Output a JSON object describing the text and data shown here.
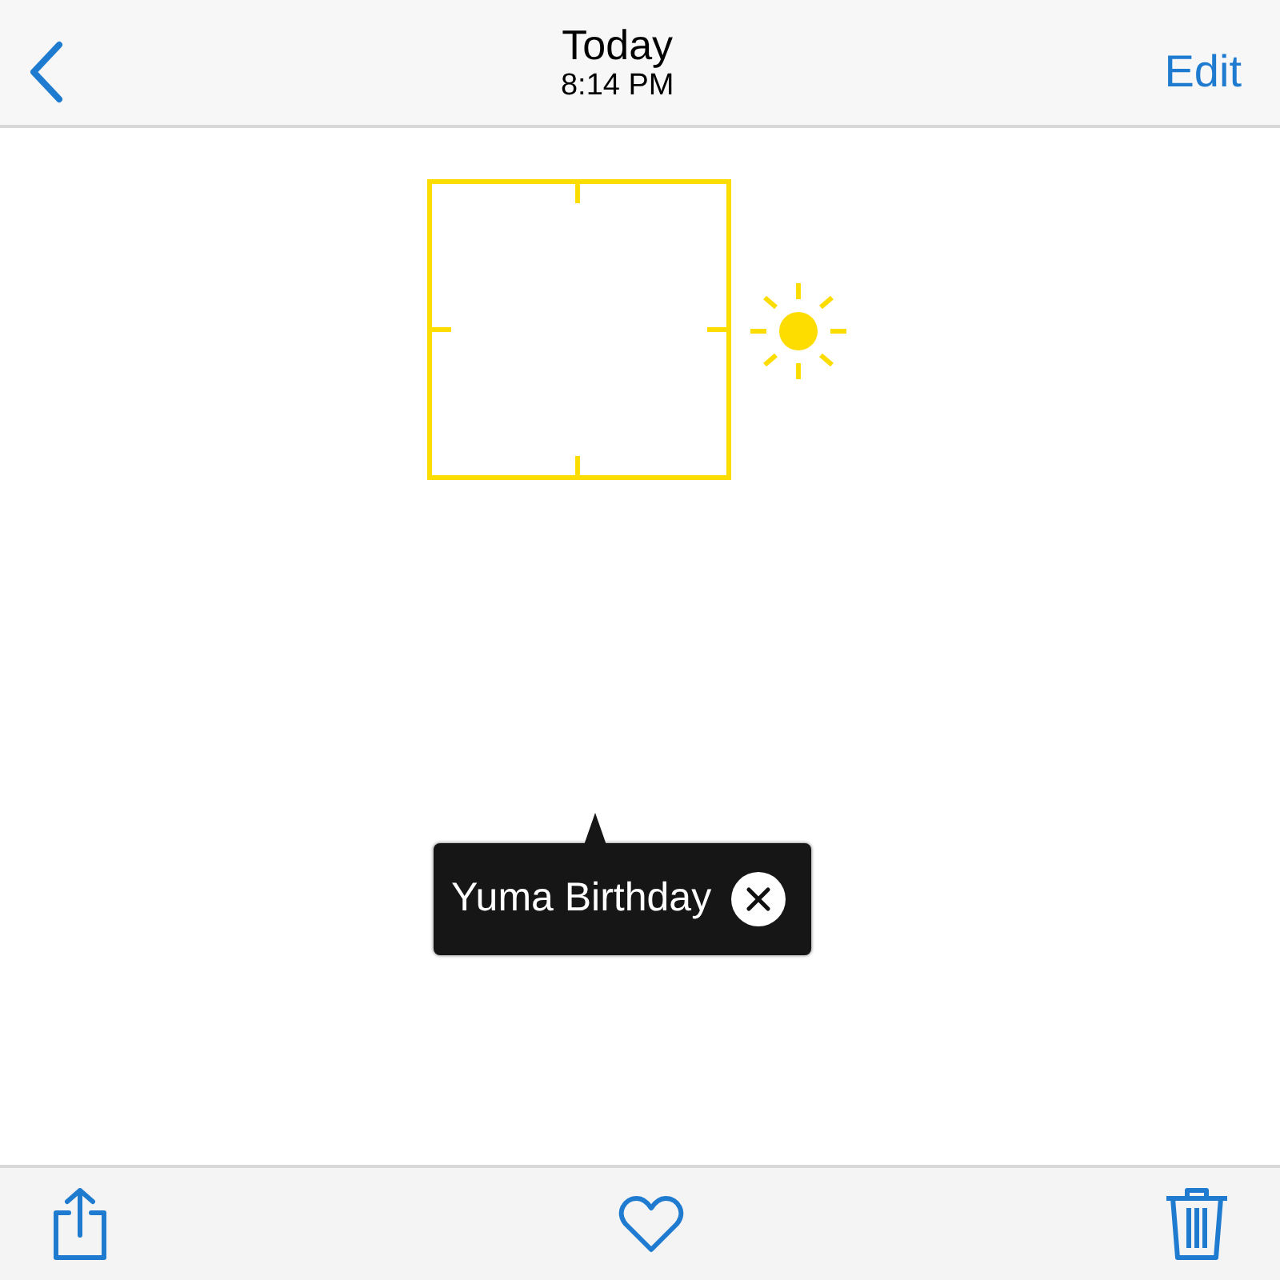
{
  "nav_bar": {
    "title": "Today",
    "subtitle": "8:14 PM",
    "edit": "Edit"
  },
  "face_tag": {
    "label": "Yuma Birthday"
  },
  "toolbar": {
    "favorite": false
  }
}
